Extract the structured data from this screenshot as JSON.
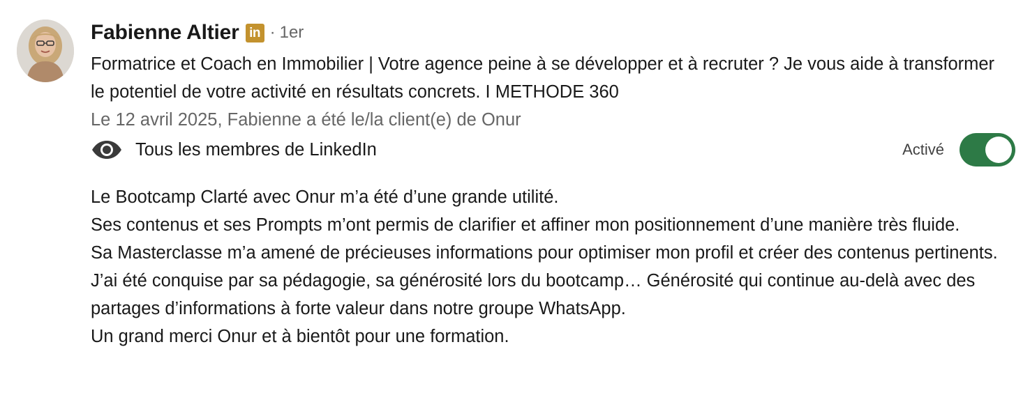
{
  "author": {
    "name": "Fabienne Altier",
    "badge": "in",
    "separator": "·",
    "degree": "1er",
    "headline": "Formatrice et Coach en Immobilier | Votre agence peine à se développer et à recruter ? Je vous aide à transformer le potentiel de votre activité en résultats concrets. I METHODE 360",
    "avatar_icon": "profile-photo"
  },
  "relationship": {
    "text": "Le 12 avril 2025, Fabienne a été le/la client(e) de Onur"
  },
  "visibility": {
    "icon": "eye-icon",
    "label": "Tous les membres de LinkedIn"
  },
  "toggle": {
    "label": "Activé",
    "state": "on",
    "color": "#2d7a46"
  },
  "recommendation": {
    "lines": [
      "Le Bootcamp Clarté avec Onur m’a été d’une grande utilité.",
      "Ses contenus et ses Prompts m’ont permis de clarifier et affiner mon positionnement d’une manière très fluide.",
      "Sa Masterclasse m’a amené de précieuses informations pour optimiser mon profil et créer des contenus pertinents.",
      "J’ai été conquise par sa pédagogie, sa générosité lors du bootcamp… Générosité qui continue au-delà avec des partages d’informations à forte valeur dans notre groupe WhatsApp.",
      "Un grand merci Onur et à bientôt pour une formation."
    ]
  },
  "colors": {
    "badge": "#c3922e",
    "secondary_text": "#666666"
  }
}
